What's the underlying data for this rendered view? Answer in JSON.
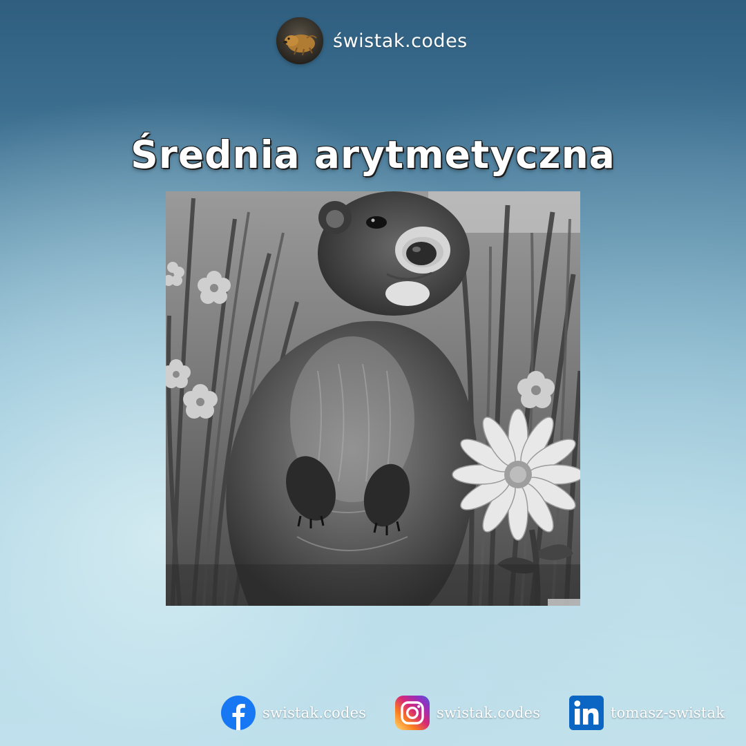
{
  "brand": {
    "name": "świstak.codes",
    "logo_icon": "marmot-logo-icon"
  },
  "title": "Średnia arytmetyczna",
  "illustration": {
    "icon": "marmot-painting-illustration",
    "colors": {
      "dark": "#2b2b2b",
      "mid": "#6f6f6f",
      "light": "#d9d9d9"
    }
  },
  "socials": [
    {
      "platform": "facebook",
      "icon": "facebook-icon",
      "handle": "swistak.codes",
      "color": "#1877f2"
    },
    {
      "platform": "instagram",
      "icon": "instagram-icon",
      "handle": "swistak.codes",
      "color": "#e1306c"
    },
    {
      "platform": "linkedin",
      "icon": "linkedin-icon",
      "handle": "tomasz-swistak",
      "color": "#0a66c2"
    }
  ]
}
